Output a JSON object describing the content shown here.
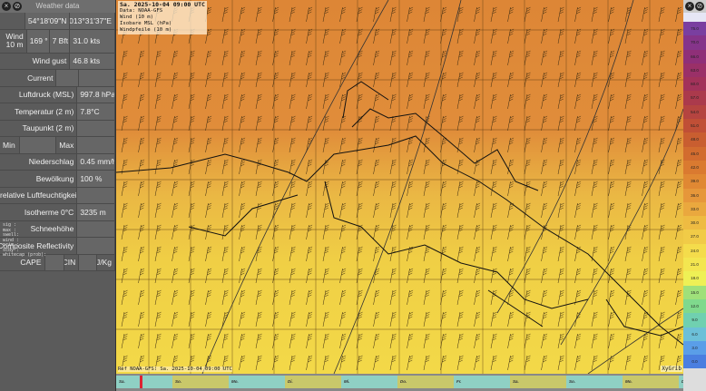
{
  "panel": {
    "title": "Weather data",
    "lat": "54°18'09\"N",
    "lon": "013°31'37\"E",
    "wind_label": "Wind\n10 m",
    "wind_dir": "169 °",
    "wind_bft": "7 Bft",
    "wind_speed": "31.0  kts",
    "gust_label": "Wind gust",
    "gust_value": "46.8  kts",
    "current_label": "Current",
    "pressure_label": "Luftdruck (MSL)",
    "pressure_value": "997.8 hPa",
    "temp_label": "Temperatur (2 m)",
    "temp_value": "7.8°C",
    "dew_label": "Taupunkt (2 m)",
    "min_label": "Min",
    "max_label": "Max",
    "precip_label": "Niederschlag",
    "precip_value": "0.45 mm/h",
    "cloud_label": "Bewölkung",
    "cloud_value": "100 %",
    "humidity_label": "relative Luftfeuchtigkeit (",
    "iso_label": "Isotherme 0°C",
    "iso_value": "3235 m",
    "snow_label": "Schneehöhe",
    "refl_label": "Composite Reflectivity",
    "cape_label": "CAPE",
    "cin_label": "CIN",
    "cape_unit": "J/Kg",
    "raw": "sig :\nmax :\nswell:\nwind :\nprim :\nscdy :\nwhitecap (prob):"
  },
  "map": {
    "info": [
      "Sa. 2025-10-04 09:00 UTC",
      "Data: NOAA-GFS",
      "Wind (10 m)",
      "Isobare MSL (hPa)",
      "Windpfeile (10 m)"
    ],
    "ref": "Ref NOAA-GFS: Sa. 2025-10-04 09:00 UTC",
    "brand": "XyGrib"
  },
  "timeline": {
    "days": [
      "Sa.",
      "So.",
      "Mo.",
      "Di.",
      "Mi.",
      "Do.",
      "Fr.",
      "Sa.",
      "So.",
      "Mo.",
      "Di."
    ],
    "colors": [
      "#8fd0c4",
      "#c9c86a"
    ]
  },
  "legend": {
    "values": [
      "75.0",
      "70.0",
      "66.0",
      "63.0",
      "60.0",
      "57.0",
      "54.0",
      "51.0",
      "48.0",
      "45.0",
      "42.0",
      "39.0",
      "36.0",
      "33.0",
      "30.0",
      "27.0",
      "24.0",
      "21.0",
      "18.0",
      "15.0",
      "12.0",
      "9.0",
      "6.0",
      "3.0",
      "0.0"
    ],
    "colors": [
      "#7a3fa0",
      "#85348a",
      "#8f2f78",
      "#9a3068",
      "#a2325a",
      "#ab3a4c",
      "#b54440",
      "#c04f36",
      "#c95e30",
      "#d26c2f",
      "#da7a30",
      "#e08833",
      "#e6973a",
      "#eaa83e",
      "#eebb42",
      "#f1cb47",
      "#f4dc4b",
      "#f3e650",
      "#eef055",
      "#9fe07a",
      "#7fd98d",
      "#70d0b0",
      "#6cc0d8",
      "#5a9ee8",
      "#4a7fe0"
    ]
  }
}
